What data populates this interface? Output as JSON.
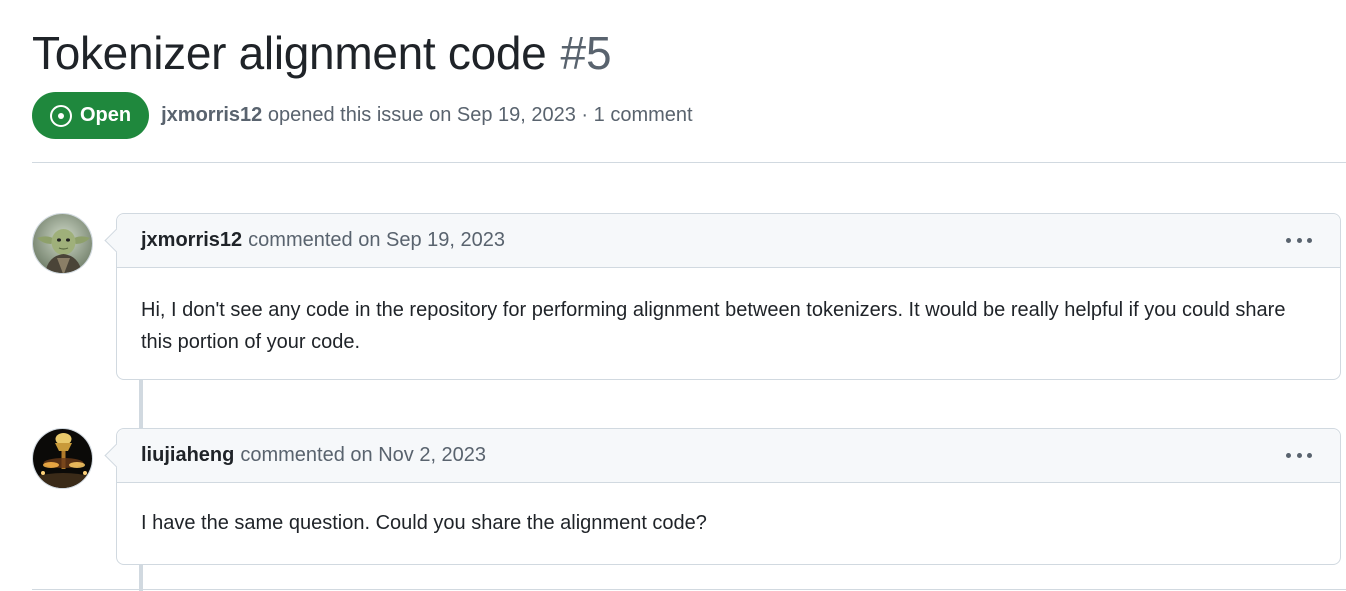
{
  "issue": {
    "title": "Tokenizer alignment code",
    "number": "#5",
    "state": "Open",
    "author": "jxmorris12",
    "opened_text": "opened this issue on Sep 19, 2023 · 1 comment"
  },
  "comments": [
    {
      "author": "jxmorris12",
      "meta": "commented on Sep 19, 2023",
      "body": "Hi, I don't see any code in the repository for performing alignment between tokenizers. It would be really helpful if you could share this portion of your code.",
      "avatar_icon": "yoda-avatar"
    },
    {
      "author": "liujiaheng",
      "meta": "commented on Nov 2, 2023",
      "body": "I have the same question. Could you share the alignment code?",
      "avatar_icon": "night-light-avatar"
    }
  ],
  "colors": {
    "open_green": "#1f883d",
    "muted_text": "#59636e",
    "border": "#d1d9e0",
    "header_bg": "#f6f8fa"
  }
}
